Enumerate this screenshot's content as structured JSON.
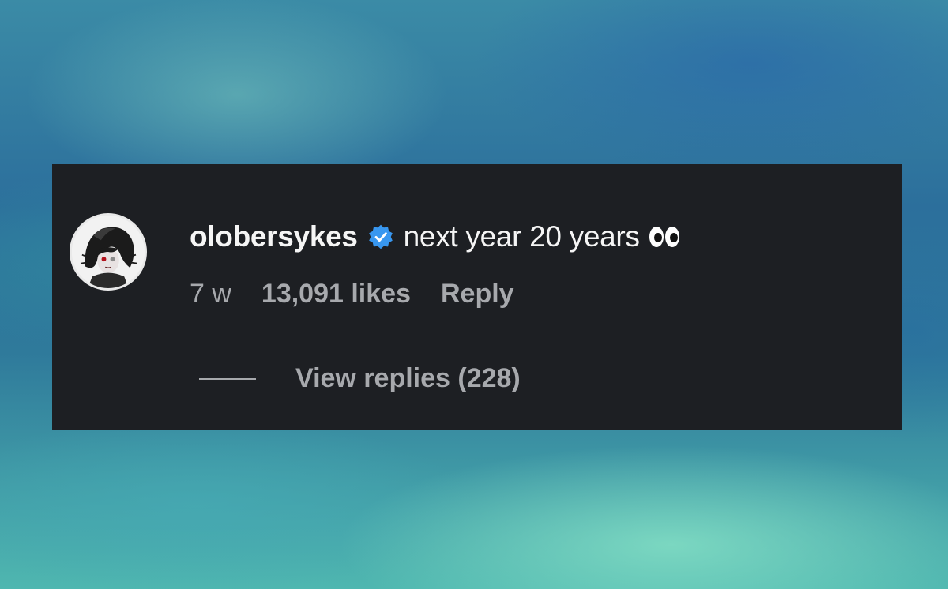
{
  "comment": {
    "username": "olobersykes",
    "text": "next year 20 years",
    "emoji_icon": "eyes-emoji-icon",
    "verified_icon": "verified-badge-icon",
    "time": "7 w",
    "likes": "13,091 likes",
    "reply_label": "Reply",
    "view_replies_label": "View replies (228)"
  },
  "colors": {
    "card_background": "#1d1f23",
    "primary_text": "#f5f5f5",
    "secondary_text": "#a7a9ad",
    "verified_blue": "#3897f0"
  }
}
